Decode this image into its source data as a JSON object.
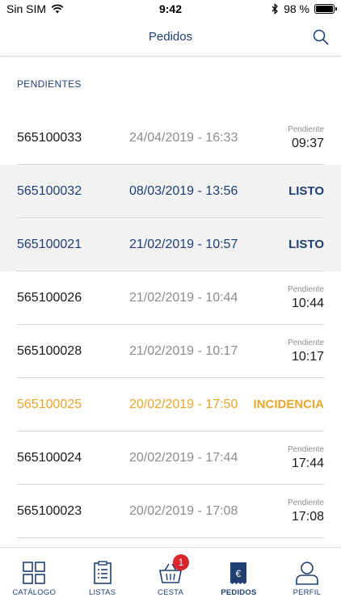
{
  "status_bar": {
    "carrier": "Sin SIM",
    "time": "9:42",
    "battery": "98 %",
    "battery_level": 0.98
  },
  "header": {
    "title": "Pedidos"
  },
  "section": {
    "title": "PENDIENTES"
  },
  "orders": [
    {
      "code": "565100033",
      "date": "24/04/2019 - 16:33",
      "status_label": "Pendiente",
      "status_value": "09:37",
      "state": "pending"
    },
    {
      "code": "565100032",
      "date": "08/03/2019 - 13:56",
      "status_label": "",
      "status_value": "LISTO",
      "state": "ready"
    },
    {
      "code": "565100021",
      "date": "21/02/2019 - 10:57",
      "status_label": "",
      "status_value": "LISTO",
      "state": "ready"
    },
    {
      "code": "565100026",
      "date": "21/02/2019 - 10:44",
      "status_label": "Pendiente",
      "status_value": "10:44",
      "state": "pending"
    },
    {
      "code": "565100028",
      "date": "21/02/2019 - 10:17",
      "status_label": "Pendiente",
      "status_value": "10:17",
      "state": "pending"
    },
    {
      "code": "565100025",
      "date": "20/02/2019 - 17:50",
      "status_label": "",
      "status_value": "INCIDENCIA",
      "state": "incident"
    },
    {
      "code": "565100024",
      "date": "20/02/2019 - 17:44",
      "status_label": "Pendiente",
      "status_value": "17:44",
      "state": "pending"
    },
    {
      "code": "565100023",
      "date": "20/02/2019 - 17:08",
      "status_label": "Pendiente",
      "status_value": "17:08",
      "state": "pending"
    }
  ],
  "tabs": [
    {
      "label": "CATÁLOGO",
      "icon": "catalog-grid-icon"
    },
    {
      "label": "LISTAS",
      "icon": "list-clipboard-icon"
    },
    {
      "label": "CESTA",
      "icon": "basket-icon",
      "badge": "1"
    },
    {
      "label": "PEDIDOS",
      "icon": "euro-receipt-icon",
      "active": true
    },
    {
      "label": "PERFIL",
      "icon": "user-icon"
    }
  ],
  "colors": {
    "brand_blue": "#1f3f73",
    "incident_orange": "#e8a52a",
    "muted_gray": "#8d8d8d",
    "badge_red": "#d9262e"
  }
}
